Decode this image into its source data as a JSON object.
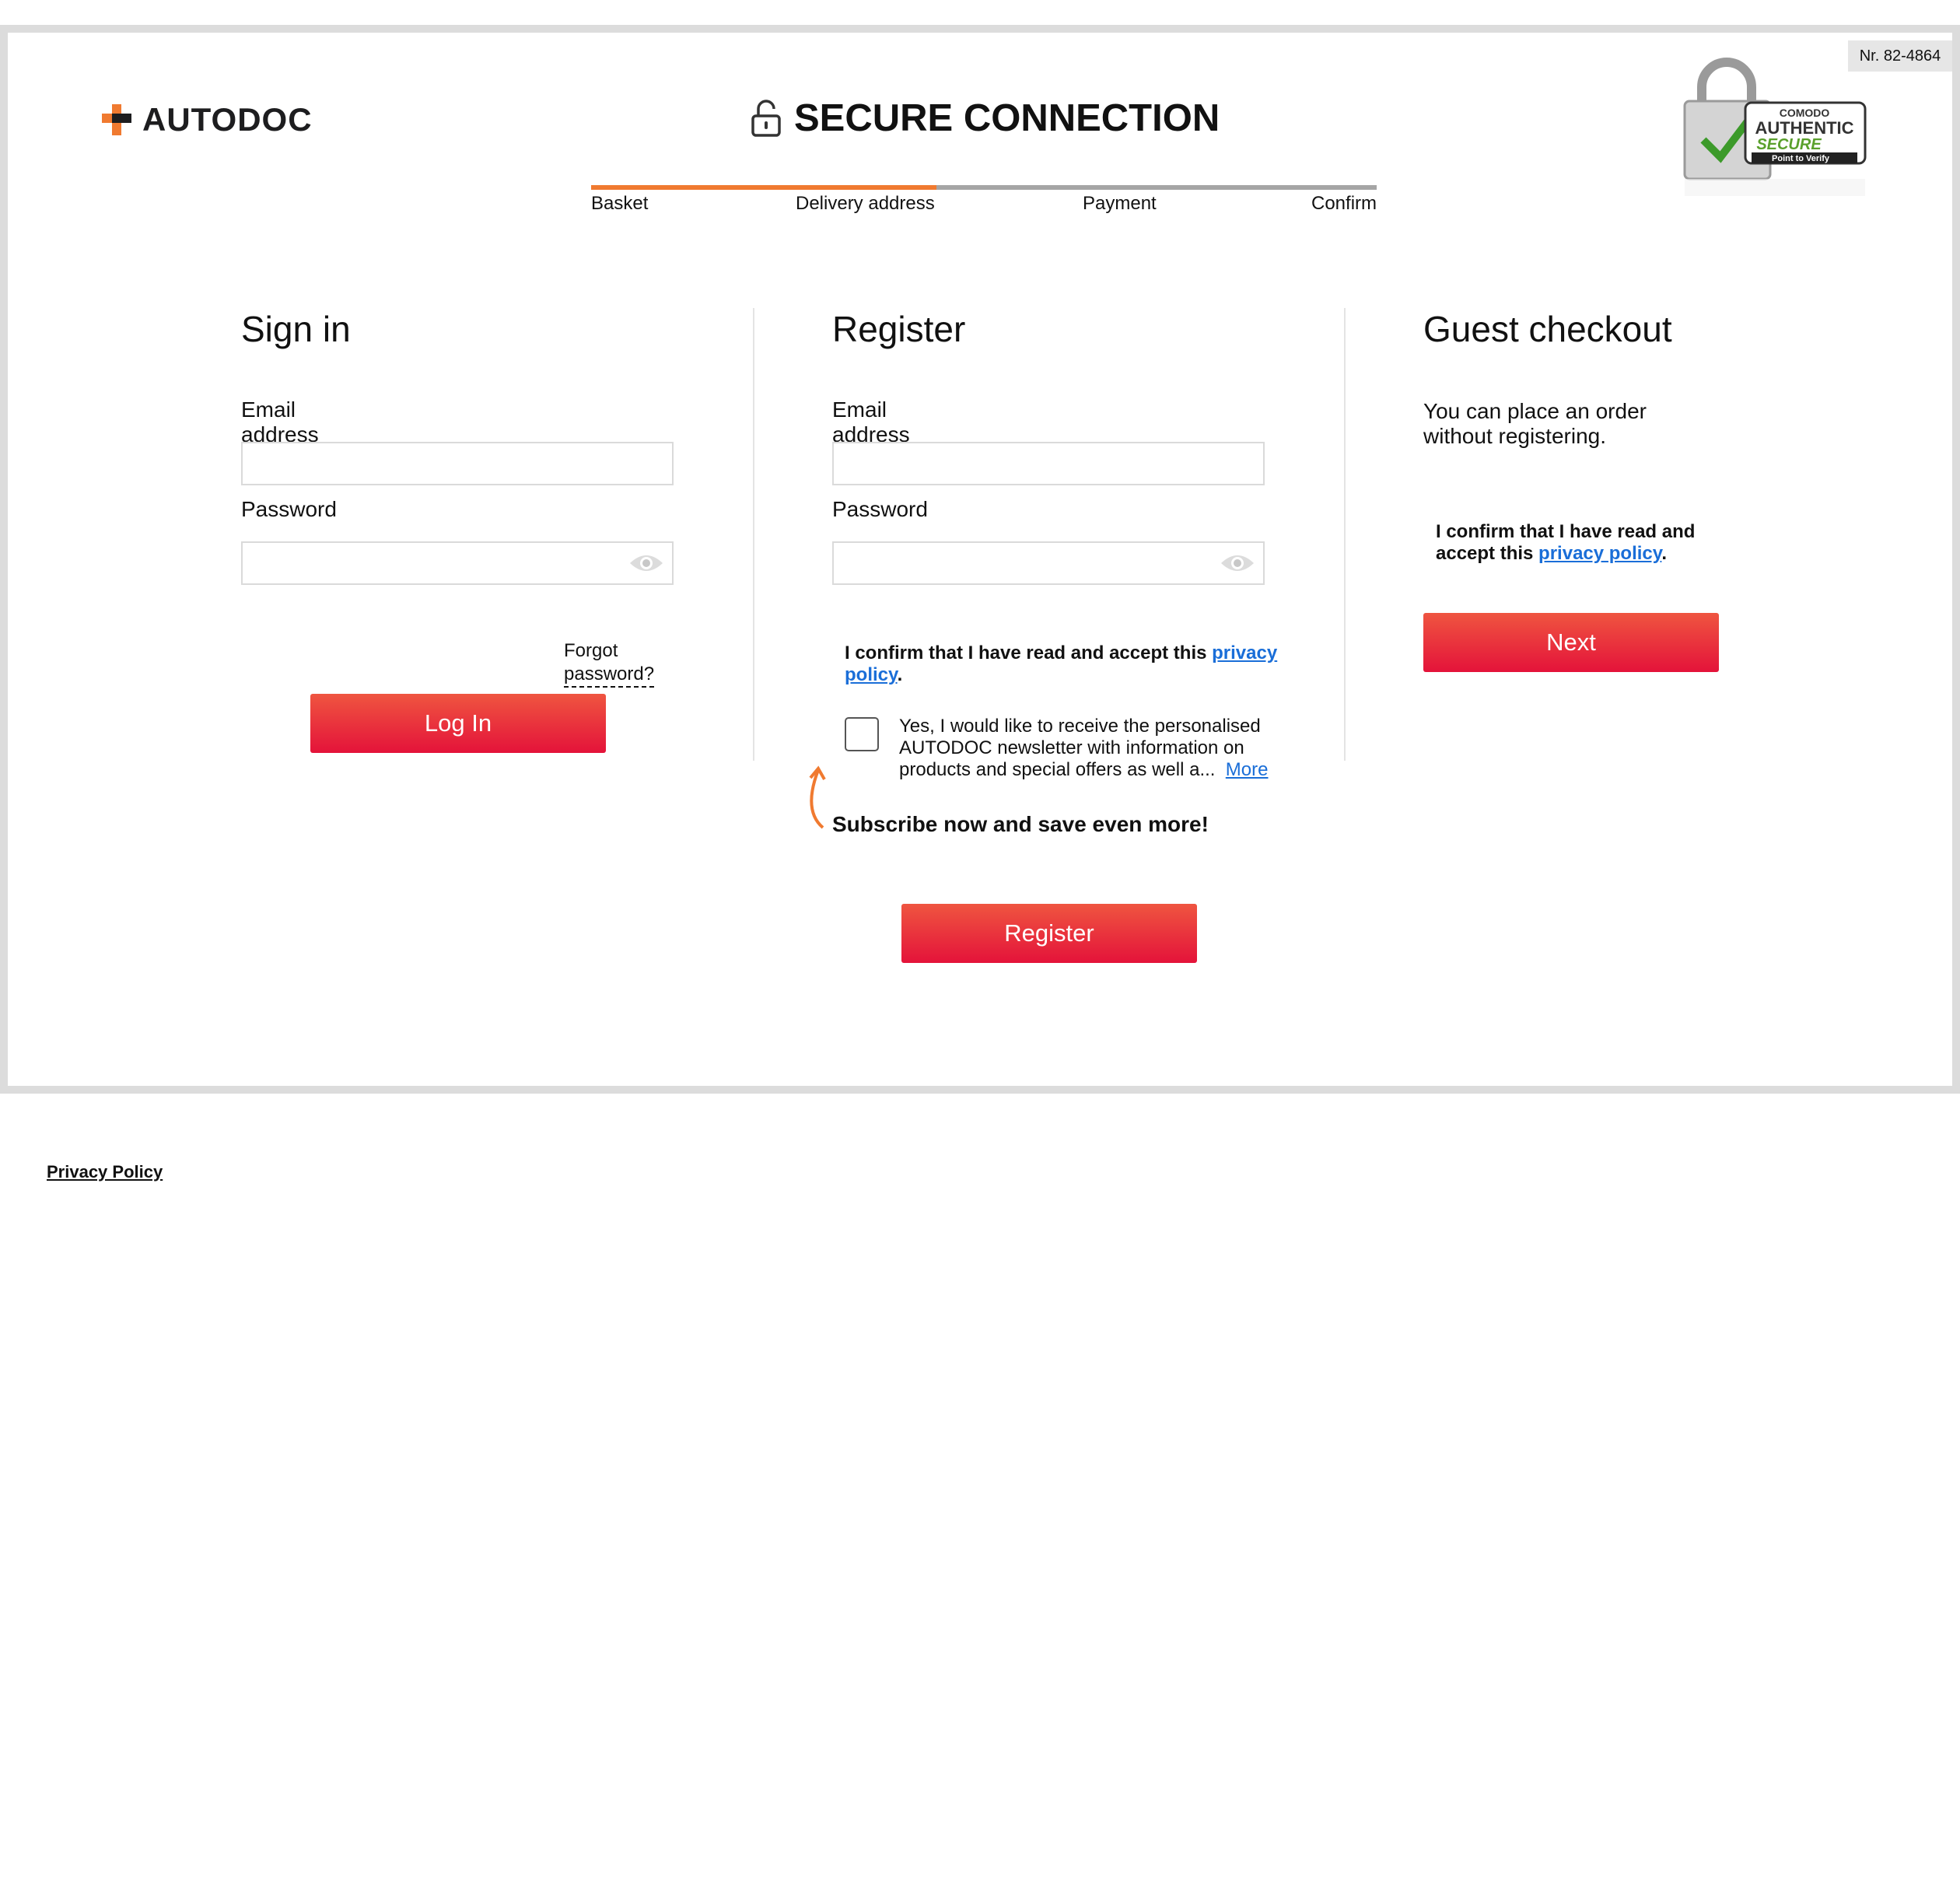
{
  "badge_nr": "Nr. 82-4864",
  "brand": {
    "name": "AUTODOC",
    "accent_color": "#f07a30",
    "logo_icon": "cross-icon"
  },
  "header": {
    "title": "SECURE CONNECTION",
    "icon": "padlock-icon"
  },
  "trust_seal": {
    "top_text": "COMODO",
    "line1": "AUTHENTIC",
    "line2": "SECURE",
    "line3": "Point to Verify"
  },
  "progress": {
    "steps": [
      "Basket",
      "Delivery address",
      "Payment",
      "Confirm"
    ],
    "current_step": "Delivery address",
    "completed_fraction": 0.44
  },
  "signin": {
    "title": "Sign in",
    "email_label": "Email address",
    "email_value": "",
    "password_label": "Password",
    "password_value": "",
    "forgot": "Forgot password?",
    "login_button": "Log In"
  },
  "register": {
    "title": "Register",
    "email_label": "Email address",
    "email_value": "",
    "password_label": "Password",
    "password_value": "",
    "confirm_text": "I confirm that I have read and accept this ",
    "privacy_link": "privacy policy",
    "confirm_end": ".",
    "newsletter_text": "Yes, I would like to receive the personalised AUTODOC newsletter with information on products and special offers as well a...",
    "more_link": "More",
    "newsletter_checked": false,
    "subscribe_text": "Subscribe now and save even more!",
    "register_button": "Register"
  },
  "guest": {
    "title": "Guest checkout",
    "description": "You can place an order without registering.",
    "confirm_text": "I confirm that I have read and accept this ",
    "privacy_link": "privacy policy",
    "confirm_end": ".",
    "next_button": "Next"
  },
  "footer": {
    "privacy_link": "Privacy Policy"
  },
  "colors": {
    "button": "#e83a3c",
    "link": "#1a6ed8",
    "progress_active": "#f07a30",
    "progress_inactive": "#a5a5a5"
  }
}
